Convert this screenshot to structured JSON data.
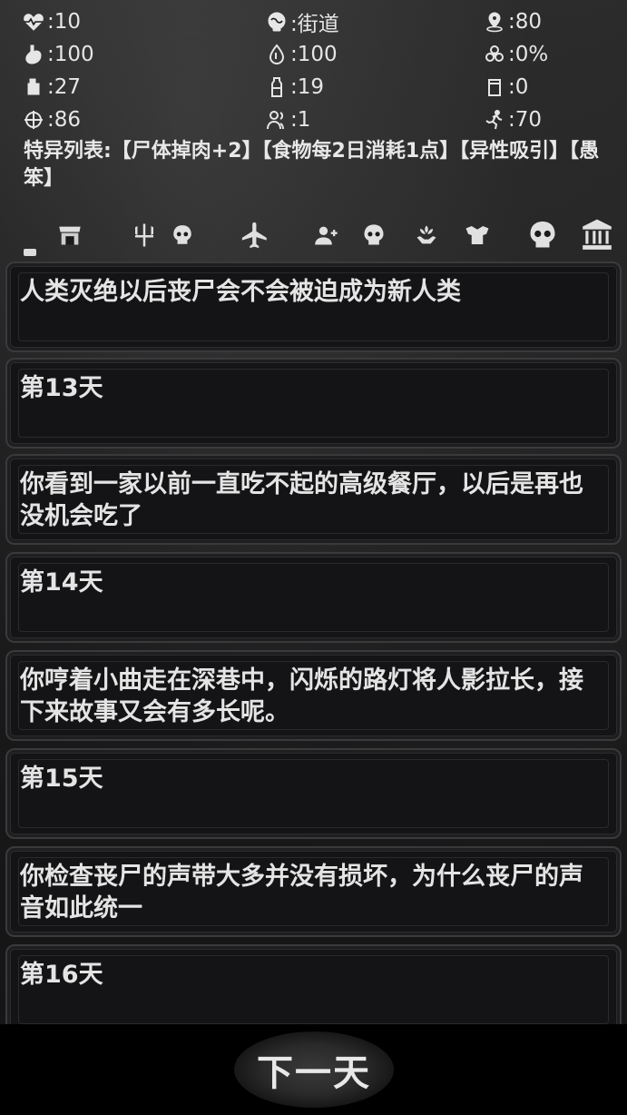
{
  "stats": [
    {
      "icon": "heart-pulse-icon",
      "value": ":10"
    },
    {
      "icon": "brain-icon",
      "value": ":街道"
    },
    {
      "icon": "location-pin-icon",
      "value": ":80"
    },
    {
      "icon": "stomach-icon",
      "value": ":100"
    },
    {
      "icon": "water-drop-icon",
      "value": ":100"
    },
    {
      "icon": "biohazard-icon",
      "value": ":0%"
    },
    {
      "icon": "food-can-icon",
      "value": ":27"
    },
    {
      "icon": "water-bottle-icon",
      "value": ":19"
    },
    {
      "icon": "barrel-icon",
      "value": ":0"
    },
    {
      "icon": "crosshair-icon",
      "value": ":86"
    },
    {
      "icon": "survivors-icon",
      "value": ":1"
    },
    {
      "icon": "running-icon",
      "value": ":70"
    }
  ],
  "traits_text": "特异列表:【尸体掉肉+2】【食物每2日消耗1点】【异性吸引】【愚笨】",
  "iconbar": [
    "shop-icon",
    "trident-icon",
    "skull-icon",
    "airplane-icon",
    "add-person-icon",
    "skull-icon",
    "hand-sprout-icon",
    "muscle-icon",
    "skull-large-icon",
    "museum-icon"
  ],
  "log": [
    "人类灭绝以后丧尸会不会被迫成为新人类",
    "第13天",
    "你看到一家以前一直吃不起的高级餐厅，以后是再也没机会吃了",
    "第14天",
    "你哼着小曲走在深巷中，闪烁的路灯将人影拉长，接下来故事又会有多长呢。",
    "第15天",
    "你检查丧尸的声带大多并没有损坏，为什么丧尸的声音如此统一",
    "第16天"
  ],
  "next_button": "下一天"
}
